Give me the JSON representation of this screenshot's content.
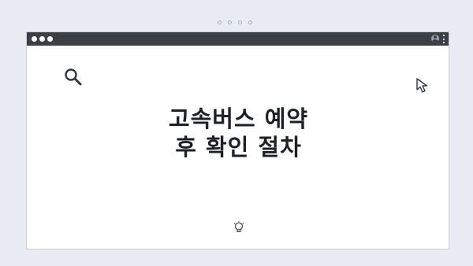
{
  "page": {
    "headline_line1": "고속버스 예약",
    "headline_line2": "후 확인 절차"
  },
  "icons": {
    "window_controls": [
      "dot",
      "dot",
      "dot"
    ],
    "top_indicator": [
      "dot",
      "dot",
      "dot",
      "dot"
    ],
    "toolbar_right": [
      "user-icon",
      "kebab-menu-icon"
    ],
    "decorations": [
      "search-icon",
      "cursor-icon",
      "lightbulb-icon"
    ]
  },
  "colors": {
    "background": "#e8ecf2",
    "titlebar": "#3c3f44",
    "window": "#ffffff",
    "text": "#1e2023"
  }
}
